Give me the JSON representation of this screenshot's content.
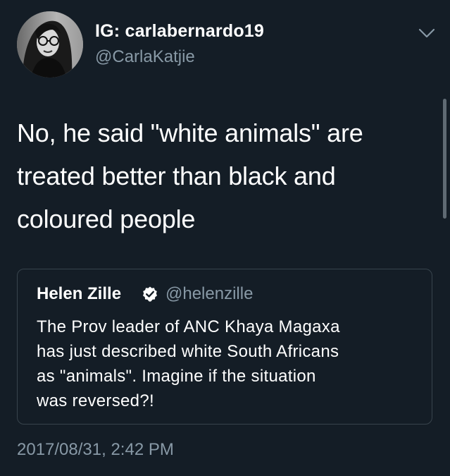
{
  "author": {
    "display_name": "IG: carlabernardo19",
    "handle": "@CarlaKatjie",
    "avatar": "profile-photo"
  },
  "tweet": {
    "text_lines": [
      "No, he said \"white animals\" are",
      "treated better than black and",
      "coloured people"
    ],
    "timestamp": "2017/08/31, 2:42 PM"
  },
  "quoted_tweet": {
    "display_name": "Helen Zille",
    "verified": true,
    "handle": "@helenzille",
    "text_lines": [
      "The Prov leader of ANC Khaya Magaxa",
      "has just described white South Africans",
      "as \"animals\".  Imagine if the situation",
      "was reversed?!"
    ]
  },
  "icons": {
    "menu": "chevron-down-icon",
    "verified": "verified-badge-icon"
  },
  "colors": {
    "background": "#141d26",
    "primary_text": "#ffffff",
    "secondary_text": "#8899a6",
    "card_border": "#38444d"
  }
}
